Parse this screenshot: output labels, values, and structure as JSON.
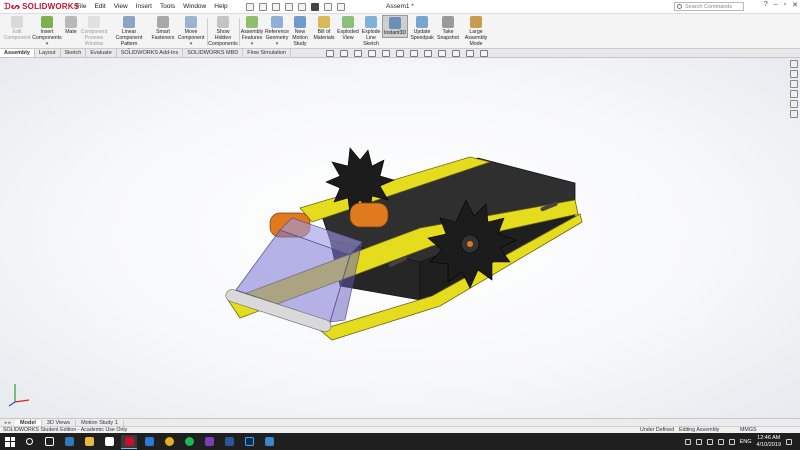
{
  "app": {
    "logo_text": "SOLIDWORKS",
    "document_title": "Assem1 *",
    "menus": [
      "File",
      "Edit",
      "View",
      "Insert",
      "Tools",
      "Window",
      "Help"
    ],
    "search_placeholder": "Search Commands"
  },
  "ribbon": {
    "edit_component": "Edit Component",
    "insert_components": "Insert Components",
    "mate": "Mate",
    "component_preview": "Component Preview Window",
    "linear_pattern": "Linear Component Pattern",
    "smart_fasteners": "Smart Fasteners",
    "move_component": "Move Component",
    "show_hidden": "Show Hidden Components",
    "assembly_features": "Assembly Features",
    "reference_geometry": "Reference Geometry",
    "new_motion_study": "New Motion Study",
    "bill_of_materials": "Bill of Materials",
    "exploded_view": "Exploded View",
    "explode_line_sketch": "Explode Line Sketch",
    "instant3d": "Instant3D",
    "update_speedpak": "Update Speedpak",
    "take_snapshot": "Take Snapshot",
    "large_assembly_mode": "Large Assembly Mode"
  },
  "tabs": [
    {
      "label": "Assembly"
    },
    {
      "label": "Layout"
    },
    {
      "label": "Sketch"
    },
    {
      "label": "Evaluate"
    },
    {
      "label": "SOLIDWORKS Add-Ins"
    },
    {
      "label": "SOLIDWORKS MBD"
    },
    {
      "label": "Flow Simulation"
    }
  ],
  "model_tabs": {
    "model": "Model",
    "views_3d": "3D Views",
    "motion_study": "Motion Study 1"
  },
  "status": {
    "edition": "SOLIDWORKS Student Edition - Academic Use Only",
    "defined": "Under Defined",
    "mode": "Editing Assembly",
    "units": "MMGS"
  },
  "taskbar": {
    "language": "ENG",
    "time": "12:46 AM",
    "date": "4/10/2019"
  },
  "colors": {
    "brand": "#c8102e",
    "frame_yellow": "#e6dc1e",
    "roller_orange": "#e07a1f",
    "body_dark": "#2e2e2e",
    "tray_blue": "#7a74d6"
  }
}
